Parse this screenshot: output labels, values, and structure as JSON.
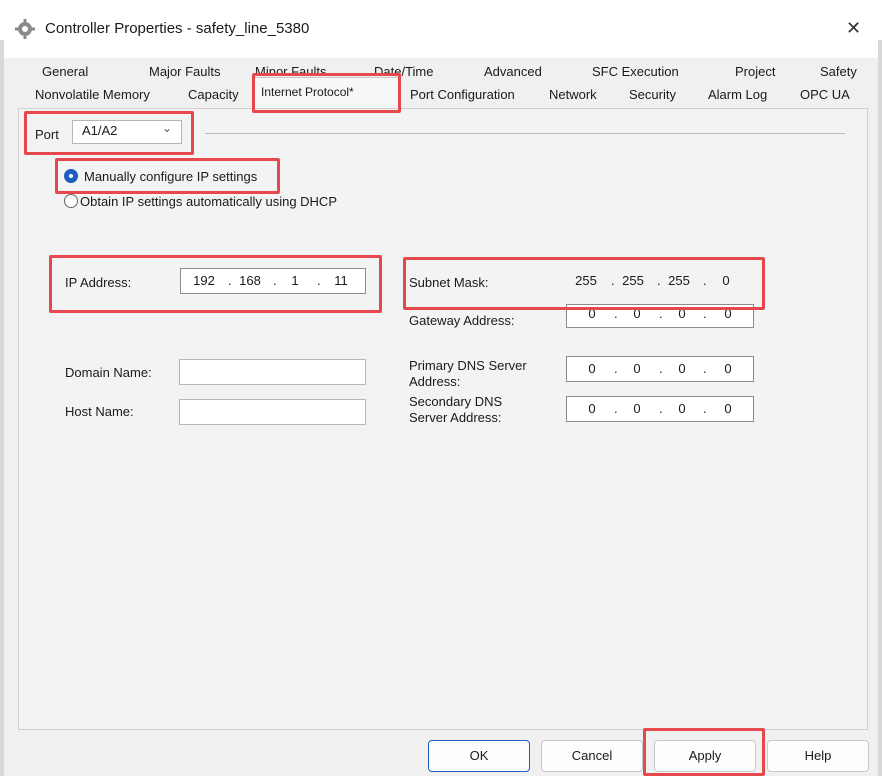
{
  "window": {
    "title": "Controller Properties - safety_line_5380",
    "close_glyph": "✕",
    "icon": "gear-icon"
  },
  "tabs_row1": [
    "General",
    "Major Faults",
    "Minor Faults",
    "Date/Time",
    "Advanced",
    "SFC Execution",
    "Project",
    "Safety"
  ],
  "tabs_row2": [
    "Nonvolatile Memory",
    "Capacity",
    "Internet Protocol*",
    "Port Configuration",
    "Network",
    "Security",
    "Alarm Log",
    "OPC UA"
  ],
  "port": {
    "label": "Port",
    "value": "A1/A2"
  },
  "radios": {
    "manual_label": "Manually configure IP settings",
    "dhcp_label": "Obtain IP settings automatically using DHCP",
    "selected": "manual"
  },
  "ip_address": {
    "label": "IP Address:",
    "octets": [
      "192",
      "168",
      "1",
      "11"
    ]
  },
  "subnet_mask": {
    "label": "Subnet Mask:",
    "octets": [
      "255",
      "255",
      "255",
      "0"
    ]
  },
  "gateway": {
    "label": "Gateway Address:",
    "octets": [
      "0",
      "0",
      "0",
      "0"
    ]
  },
  "domain_name": {
    "label": "Domain Name:",
    "value": ""
  },
  "host_name": {
    "label": "Host Name:",
    "value": ""
  },
  "primary_dns": {
    "label_line1": "Primary DNS Server",
    "label_line2": "Address:",
    "octets": [
      "0",
      "0",
      "0",
      "0"
    ]
  },
  "secondary_dns": {
    "label_line1": "Secondary DNS",
    "label_line2": "Server Address:",
    "octets": [
      "0",
      "0",
      "0",
      "0"
    ]
  },
  "buttons": {
    "ok": "OK",
    "cancel": "Cancel",
    "apply": "Apply",
    "help": "Help"
  },
  "colors": {
    "highlight": "#e5484d",
    "accent": "#1d5fbf"
  }
}
